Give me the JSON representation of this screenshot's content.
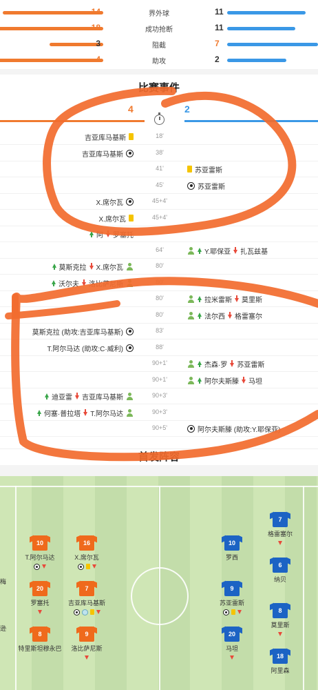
{
  "stats": [
    {
      "home": "14",
      "label": "界外球",
      "away": "11",
      "home_frac": 0.56,
      "away_frac": 0.44,
      "away_hl": false
    },
    {
      "home": "18",
      "label": "成功抢断",
      "away": "11",
      "home_frac": 0.62,
      "away_frac": 0.38,
      "away_hl": false
    },
    {
      "home": "3",
      "label": "阻截",
      "away": "7",
      "home_frac": 0.3,
      "away_frac": 0.7,
      "away_hl": true
    },
    {
      "home": "4",
      "label": "助攻",
      "away": "2",
      "home_frac": 0.67,
      "away_frac": 0.33,
      "away_hl": false
    }
  ],
  "events_title": "比赛事件",
  "score": {
    "home": "4",
    "away": "2"
  },
  "events": [
    {
      "min": "18'",
      "left": [
        {
          "t": "text",
          "v": "吉亚库马基斯"
        },
        {
          "t": "icon",
          "v": "yellow-card-icon"
        }
      ],
      "right": []
    },
    {
      "min": "38'",
      "left": [
        {
          "t": "text",
          "v": "吉亚库马基斯"
        },
        {
          "t": "icon",
          "v": "ball-icon"
        }
      ],
      "right": []
    },
    {
      "min": "41'",
      "left": [],
      "right": [
        {
          "t": "icon",
          "v": "yellow-card-icon"
        },
        {
          "t": "text",
          "v": "苏亚雷斯"
        }
      ]
    },
    {
      "min": "45'",
      "left": [],
      "right": [
        {
          "t": "icon",
          "v": "ball-icon"
        },
        {
          "t": "text",
          "v": "苏亚雷斯"
        }
      ]
    },
    {
      "min": "45+4'",
      "left": [
        {
          "t": "text",
          "v": "X.席尔瓦"
        },
        {
          "t": "icon",
          "v": "ball-icon"
        }
      ],
      "right": []
    },
    {
      "min": "45+4'",
      "left": [
        {
          "t": "text",
          "v": "X.席尔瓦"
        },
        {
          "t": "icon",
          "v": "yellow-card-icon"
        }
      ],
      "right": []
    },
    {
      "min": "",
      "left": [
        {
          "t": "icon",
          "v": "up-icon"
        },
        {
          "t": "text",
          "v": "阿"
        },
        {
          "t": "icon",
          "v": "down-icon"
        },
        {
          "t": "text",
          "v": "罗塞托"
        }
      ],
      "right": []
    },
    {
      "min": "64'",
      "left": [],
      "right": [
        {
          "t": "icon",
          "v": "person-icon"
        },
        {
          "t": "icon",
          "v": "up-icon"
        },
        {
          "t": "text",
          "v": "Y.耶保亚"
        },
        {
          "t": "icon",
          "v": "down-icon"
        },
        {
          "t": "text",
          "v": "扎瓦兹基"
        }
      ]
    },
    {
      "min": "80'",
      "left": [
        {
          "t": "icon",
          "v": "up-icon"
        },
        {
          "t": "text",
          "v": "莫斯克拉"
        },
        {
          "t": "icon",
          "v": "down-icon"
        },
        {
          "t": "text",
          "v": "X.席尔瓦"
        },
        {
          "t": "icon",
          "v": "person-icon"
        }
      ],
      "right": []
    },
    {
      "min": "80'",
      "left": [
        {
          "t": "icon",
          "v": "up-icon"
        },
        {
          "t": "text",
          "v": "沃尔夫"
        },
        {
          "t": "icon",
          "v": "down-icon"
        },
        {
          "t": "text",
          "v": "洛比萨尼斯"
        },
        {
          "t": "icon",
          "v": "person-icon"
        }
      ],
      "right": []
    },
    {
      "min": "80'",
      "left": [],
      "right": [
        {
          "t": "icon",
          "v": "person-icon"
        },
        {
          "t": "icon",
          "v": "up-icon"
        },
        {
          "t": "text",
          "v": "拉米雷斯"
        },
        {
          "t": "icon",
          "v": "down-icon"
        },
        {
          "t": "text",
          "v": "莫里斯"
        }
      ]
    },
    {
      "min": "80'",
      "left": [],
      "right": [
        {
          "t": "icon",
          "v": "person-icon"
        },
        {
          "t": "icon",
          "v": "up-icon"
        },
        {
          "t": "text",
          "v": "法尔西"
        },
        {
          "t": "icon",
          "v": "down-icon"
        },
        {
          "t": "text",
          "v": "格雷塞尔"
        }
      ]
    },
    {
      "min": "83'",
      "left": [
        {
          "t": "text",
          "v": "莫斯克拉 (助攻:吉亚库马基斯)"
        },
        {
          "t": "icon",
          "v": "ball-icon"
        }
      ],
      "right": []
    },
    {
      "min": "88'",
      "left": [
        {
          "t": "text",
          "v": "T.阿尔马达 (助攻:C·威利)"
        },
        {
          "t": "icon",
          "v": "ball-icon"
        }
      ],
      "right": []
    },
    {
      "min": "90+1'",
      "left": [],
      "right": [
        {
          "t": "icon",
          "v": "person-icon"
        },
        {
          "t": "icon",
          "v": "up-icon"
        },
        {
          "t": "text",
          "v": "杰森·罗"
        },
        {
          "t": "icon",
          "v": "down-icon"
        },
        {
          "t": "text",
          "v": "苏亚雷斯"
        }
      ]
    },
    {
      "min": "90+1'",
      "left": [],
      "right": [
        {
          "t": "icon",
          "v": "person-icon"
        },
        {
          "t": "icon",
          "v": "up-icon"
        },
        {
          "t": "text",
          "v": "阿尔夫斯滕"
        },
        {
          "t": "icon",
          "v": "down-icon"
        },
        {
          "t": "text",
          "v": "马坦"
        }
      ]
    },
    {
      "min": "90+3'",
      "left": [
        {
          "t": "icon",
          "v": "up-icon"
        },
        {
          "t": "text",
          "v": "迪亚雷"
        },
        {
          "t": "icon",
          "v": "down-icon"
        },
        {
          "t": "text",
          "v": "吉亚库马基斯"
        },
        {
          "t": "icon",
          "v": "person-icon"
        }
      ],
      "right": []
    },
    {
      "min": "90+3'",
      "left": [
        {
          "t": "icon",
          "v": "up-icon"
        },
        {
          "t": "text",
          "v": "何塞·普拉塔"
        },
        {
          "t": "icon",
          "v": "down-icon"
        },
        {
          "t": "text",
          "v": "T.阿尔马达"
        },
        {
          "t": "icon",
          "v": "person-icon"
        }
      ],
      "right": []
    },
    {
      "min": "90+5'",
      "left": [],
      "right": [
        {
          "t": "icon",
          "v": "ball-icon"
        },
        {
          "t": "text",
          "v": "阿尔夫斯滕 (助攻:Y.耶保亚)"
        }
      ]
    }
  ],
  "lineup_title": "首发阵容",
  "pitch": {
    "edge_left": [
      "梅",
      "逊"
    ],
    "players": [
      {
        "num": "10",
        "name": "T.阿尔马达",
        "team": "home",
        "icons": [
          "ball-icon",
          "sub-down"
        ]
      },
      {
        "num": "16",
        "name": "X.席尔瓦",
        "team": "home",
        "icons": [
          "ball-icon",
          "yellow-card-icon",
          "sub-down"
        ]
      },
      {
        "num": "20",
        "name": "罗塞托",
        "team": "home",
        "icons": [
          "sub-down"
        ]
      },
      {
        "num": "7",
        "name": "吉亚库马基斯",
        "team": "home",
        "icons": [
          "ball-icon",
          "assist-icon",
          "yellow-card-icon",
          "sub-down"
        ]
      },
      {
        "num": "8",
        "name": "特里斯坦穆永巴",
        "team": "home",
        "icons": []
      },
      {
        "num": "9",
        "name": "洛比萨尼斯",
        "team": "home",
        "icons": [
          "sub-down"
        ]
      },
      {
        "num": "7",
        "name": "格雷塞尔",
        "team": "away",
        "icons": [
          "sub-down"
        ]
      },
      {
        "num": "10",
        "name": "罗西",
        "team": "away",
        "icons": []
      },
      {
        "num": "6",
        "name": "纳贝",
        "team": "away",
        "icons": []
      },
      {
        "num": "9",
        "name": "苏亚雷斯",
        "team": "away",
        "icons": [
          "ball-icon",
          "yellow-card-icon",
          "sub-down"
        ]
      },
      {
        "num": "8",
        "name": "莫里斯",
        "team": "away",
        "icons": [
          "sub-down"
        ]
      },
      {
        "num": "20",
        "name": "马坦",
        "team": "away",
        "icons": [
          "sub-down"
        ]
      },
      {
        "num": "18",
        "name": "阿里森",
        "team": "away",
        "icons": []
      }
    ]
  },
  "colors": {
    "home": "#f07a2f",
    "away": "#3a98e6",
    "scribble": "#f26b2e"
  }
}
